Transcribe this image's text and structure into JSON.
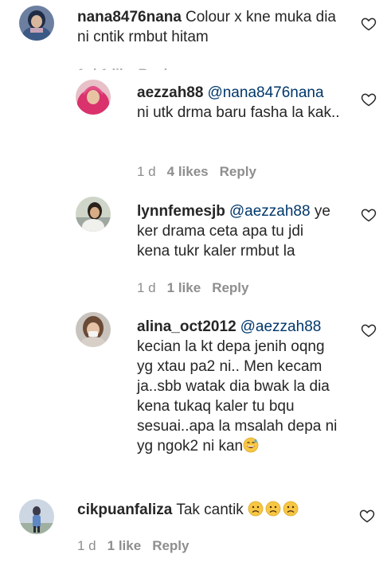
{
  "comments": [
    {
      "username": "nana8476nana",
      "mention": "",
      "text": "Colour x kne muka dia ni cntik rmbut hitam",
      "time": "",
      "likes": "",
      "reply": ""
    },
    {
      "username": "aezzah88",
      "mention": "@nana8476nana",
      "text": "ni utk drma baru fasha la kak..",
      "time": "1 d",
      "likes": "4 likes",
      "reply": "Reply"
    },
    {
      "username": "lynnfemesjb",
      "mention": "@aezzah88",
      "text": "ye ker drama ceta apa tu jdi kena tukr kaler rmbut la",
      "time": "1 d",
      "likes": "1 like",
      "reply": "Reply"
    },
    {
      "username": "alina_oct2012",
      "mention": "@aezzah88",
      "text": "kecian la kt depa jenih oqng yg xtau pa2 ni.. Men kecam ja..sbb watak dia bwak la dia kena tukaq kaler tu bqu sesuai..apa la msalah depa ni yg ngok2 ni kan",
      "time": "",
      "likes": "",
      "reply": ""
    },
    {
      "username": "cikpuanfaliza",
      "mention": "",
      "text": "Tak cantik",
      "time": "1 d",
      "likes": "1 like",
      "reply": "Reply"
    }
  ],
  "hidden_meta": "1 d   1 like   Reply",
  "icons": {
    "like": "heart-outline-icon",
    "emoji_laugh": "grinning-sweat-emoji",
    "emoji_sad": "sad-face-emoji"
  }
}
